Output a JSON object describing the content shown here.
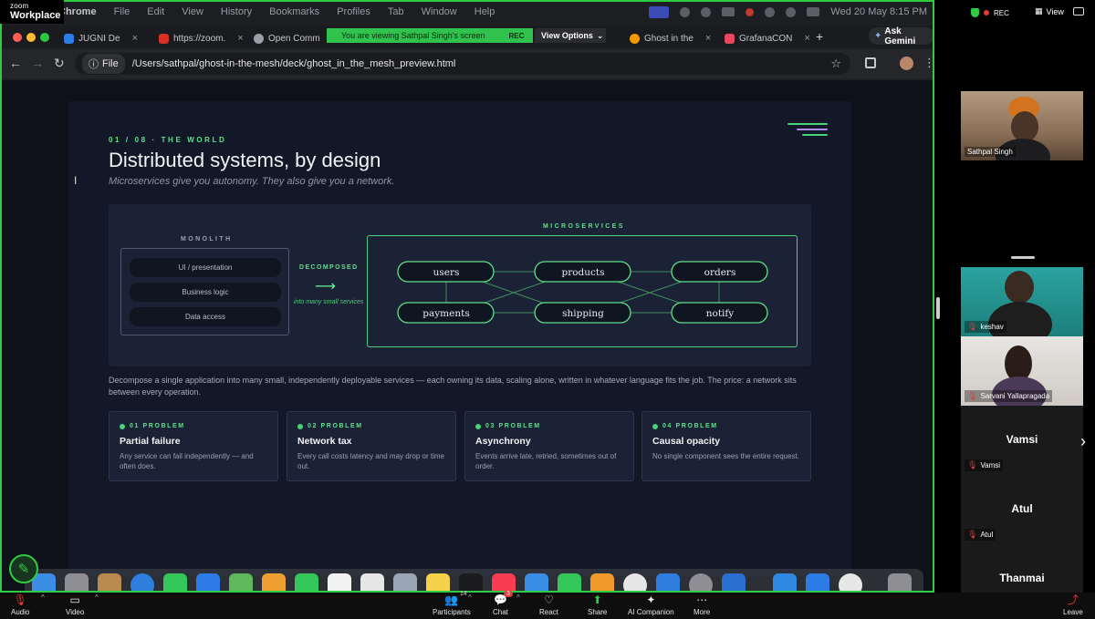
{
  "zoom": {
    "brand_small": "zoom",
    "brand": "Workplace",
    "rec_label": "REC",
    "view_label": "View",
    "toolbar": [
      {
        "name": "audio",
        "label": "Audio",
        "icon": "mic-off-icon"
      },
      {
        "name": "video",
        "label": "Video",
        "icon": "video-off-icon"
      },
      {
        "name": "participants",
        "label": "Participants",
        "icon": "participants-icon",
        "badge": "14"
      },
      {
        "name": "chat",
        "label": "Chat",
        "icon": "chat-icon",
        "badge": "3"
      },
      {
        "name": "react",
        "label": "React",
        "icon": "heart-icon"
      },
      {
        "name": "share",
        "label": "Share",
        "icon": "share-icon"
      },
      {
        "name": "ai-companion",
        "label": "AI Companion",
        "icon": "sparkle-icon"
      },
      {
        "name": "more",
        "label": "More",
        "icon": "more-icon"
      },
      {
        "name": "leave",
        "label": "Leave",
        "icon": "leave-icon"
      }
    ],
    "participants": [
      {
        "name": "Sathpal Singh",
        "muted": false,
        "video": true
      },
      {
        "name": "keshav",
        "muted": true,
        "video": true
      },
      {
        "name": "Sarvani Yallapragada",
        "muted": true,
        "video": true
      },
      {
        "name": "Vamsi",
        "muted": true,
        "video": false
      },
      {
        "name": "Atul",
        "muted": true,
        "video": false
      },
      {
        "name": "Thanmai",
        "muted": true,
        "video": false
      }
    ]
  },
  "shared": {
    "menubar": {
      "app": "Chrome",
      "menus": [
        "File",
        "Edit",
        "View",
        "History",
        "Bookmarks",
        "Profiles",
        "Tab",
        "Window",
        "Help"
      ],
      "clock": "Wed 20 May  8:15 PM"
    },
    "banner": {
      "text": "You are viewing  Sathpal Singh's screen",
      "rec": "REC",
      "view_options": "View Options"
    },
    "tabs": [
      {
        "title": "JUGNI De",
        "color": "#2d7be5"
      },
      {
        "title": "https://zoom.",
        "color": "#d93025"
      },
      {
        "title": "Open Comm",
        "color": "#9aa0a6"
      },
      {
        "title": "Ghost in the",
        "color": "#f29900"
      },
      {
        "title": "GrafanaCON",
        "color": "#e8475f"
      }
    ],
    "ask_gemini": "Ask Gemini",
    "address": {
      "chip": "File",
      "url": "/Users/sathpal/ghost-in-the-mesh/deck/ghost_in_the_mesh_preview.html"
    }
  },
  "slide": {
    "eyebrow": "01 / 08  ·  THE WORLD",
    "title": "Distributed systems, by design",
    "subtitle": "Microservices give you autonomy. They also give you a network.",
    "monolith_label": "MONOLITH",
    "layers": [
      "UI / presentation",
      "Business logic",
      "Data access"
    ],
    "decomposed_label": "DECOMPOSED",
    "decomposed_sub": "into many small services",
    "micro_label": "MICROSERVICES",
    "services": [
      "users",
      "products",
      "orders",
      "payments",
      "shipping",
      "notify"
    ],
    "body": "Decompose a single application into many small, independently deployable services — each owning its data, scaling alone, written in whatever language fits the job. The price: a network sits between every operation.",
    "problems": [
      {
        "eyebrow": "01 PROBLEM",
        "title": "Partial failure",
        "desc": "Any service can fail independently — and often does."
      },
      {
        "eyebrow": "02 PROBLEM",
        "title": "Network tax",
        "desc": "Every call costs latency and may drop or time out."
      },
      {
        "eyebrow": "03 PROBLEM",
        "title": "Asynchrony",
        "desc": "Events arrive late, retried, sometimes out of order."
      },
      {
        "eyebrow": "04 PROBLEM",
        "title": "Causal opacity",
        "desc": "No single component sees the entire request."
      }
    ]
  },
  "colors": {
    "accent": "#5fe08a",
    "zoom_green": "#2ecc40",
    "slide_bg": "#131828"
  }
}
